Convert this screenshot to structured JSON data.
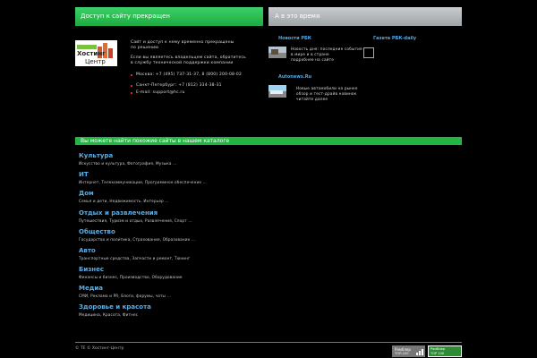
{
  "header": {
    "left_title": "Доступ к сайту прекращен",
    "right_title": "А в это время"
  },
  "logo": {
    "line1": "Хостинг",
    "line2": "Центр"
  },
  "info": {
    "line1": "Сайт и доступ к нему временно прекращены",
    "line2": "по решению",
    "line3": "Если вы являетесь владельцем сайта, обратитесь",
    "line4": "в службу технической поддержки компании",
    "contact1": "Москва: +7 (495) 737-31-37, 8 (800) 200-08-02",
    "contact2": "Санкт-Петербург: +7 (812) 334-38-31",
    "contact3": "E-mail: support@hc.ru"
  },
  "news": {
    "title1": "Новости РБК",
    "title2": "Газета РБК-daily",
    "title3": "Autonews.Ru",
    "item1_line1": "Новость дня: последние события",
    "item1_line2": "в мире и в стране",
    "item1_line3": "подробнее на сайте",
    "item2_line1": "Новые автомобили на рынке",
    "item2_line2": "обзор и тест-драйв новинок",
    "item2_line3": "читайте далее"
  },
  "catalog": {
    "bar_title": "Вы можете найти похожие сайты в нашем каталоге",
    "categories": [
      {
        "title": "Культура",
        "sub": "Искусство и культура,  Фотография,  Музыка ..."
      },
      {
        "title": "ИТ",
        "sub": "Интернет,  Телекоммуникации,  Программное обеспечение ..."
      },
      {
        "title": "Дом",
        "sub": "Семья и дети,  Недвижимость,  Интерьер ..."
      },
      {
        "title": "Отдых и развлечения",
        "sub": "Путешествия,  Туризм и отдых,  Развлечения,  Спорт ..."
      },
      {
        "title": "Общество",
        "sub": "Государство и политика,  Страхование,  Образование ..."
      },
      {
        "title": "Авто",
        "sub": "Транспортные средства,  Запчасти и ремонт,  Тюнинг"
      },
      {
        "title": "Бизнес",
        "sub": "Финансы и бизнес,  Производство,  Оборудование"
      },
      {
        "title": "Медиа",
        "sub": "СМИ,  Реклама и PR,  Блоги,  форумы,  чаты ..."
      },
      {
        "title": "Здоровье и красота",
        "sub": "Медицина,  Красота,  Фитнес"
      }
    ]
  },
  "footer": {
    "copyright": "© ТЕ © Хостинг-Центр",
    "rambler_label": "Рамблер",
    "rambler_sub": "ТОП-100",
    "top100_line1": "Рамблер",
    "top100_line2": "TOP 100"
  },
  "colors": {
    "green": "#22b744",
    "link_blue": "#5aaee6",
    "bullet_red": "#e0212d"
  }
}
